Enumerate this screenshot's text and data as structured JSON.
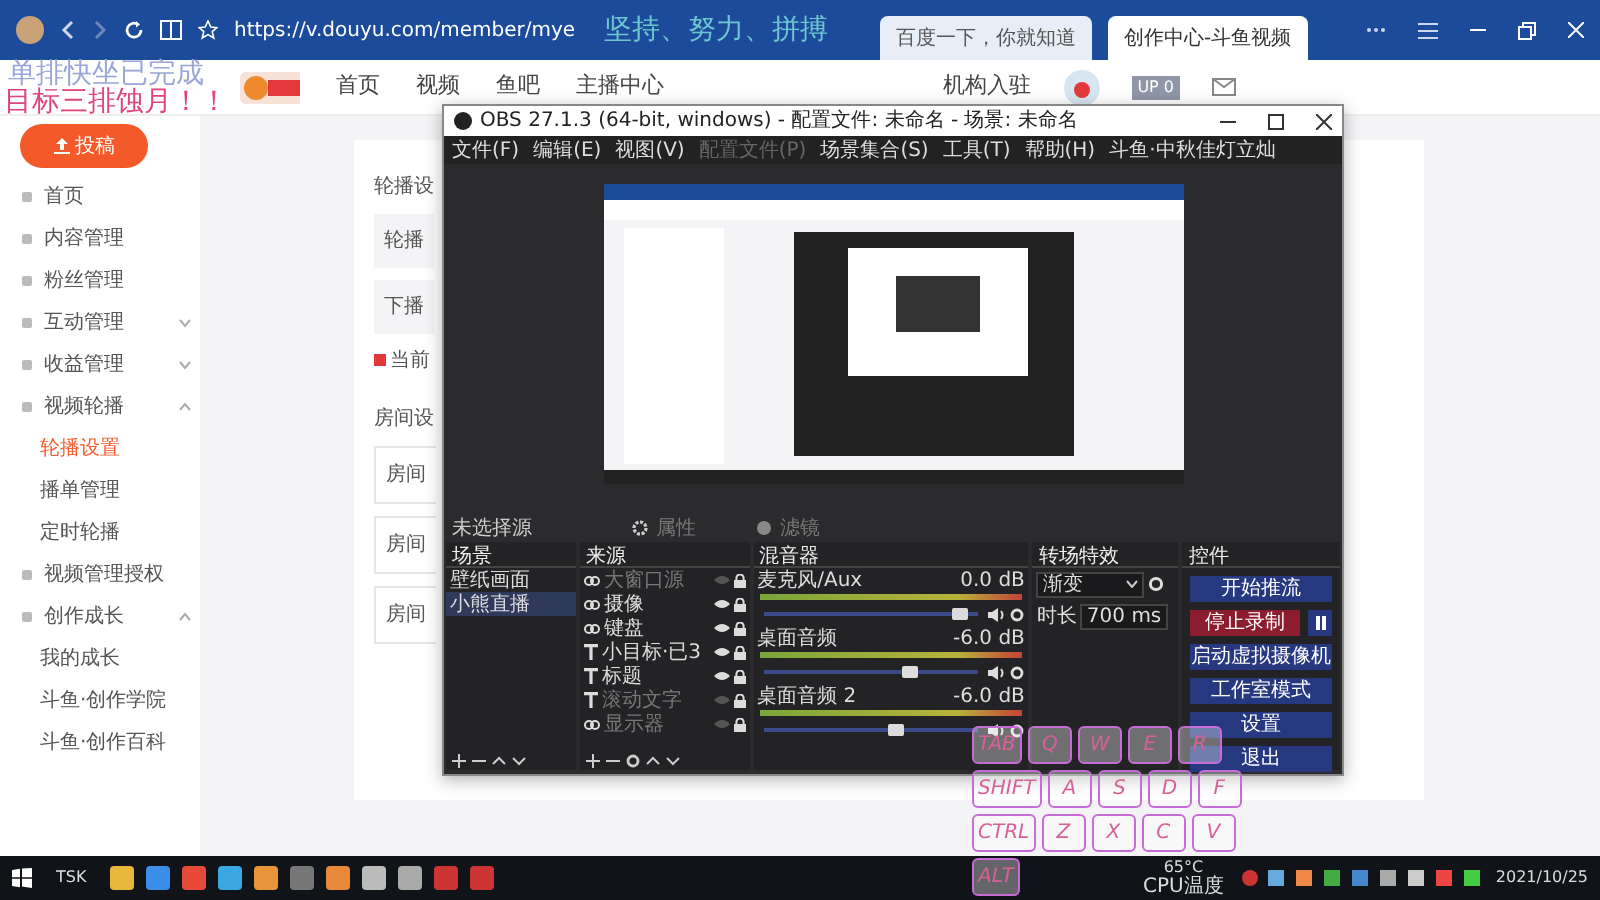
{
  "browser": {
    "url": "https://v.douyu.com/member/mye",
    "tabs": [
      {
        "label": "百度一下，你就知道",
        "selected": false
      },
      {
        "label": "创作中心-斗鱼视频",
        "selected": true
      }
    ]
  },
  "header": {
    "nav": [
      "首页",
      "视频",
      "鱼吧",
      "主播中心"
    ],
    "org_link": "机构入驻",
    "up_badge": "UP 0"
  },
  "sidebar": {
    "upload_button": "投稿",
    "items": [
      {
        "kind": "link",
        "label": "首页",
        "selected": false
      },
      {
        "kind": "link",
        "label": "内容管理",
        "selected": false
      },
      {
        "kind": "link",
        "label": "粉丝管理",
        "selected": false
      },
      {
        "kind": "group",
        "label": "互动管理",
        "expanded": false
      },
      {
        "kind": "group",
        "label": "收益管理",
        "expanded": false
      },
      {
        "kind": "group",
        "label": "视频轮播",
        "expanded": true,
        "children": [
          {
            "label": "轮播设置",
            "selected": true
          },
          {
            "label": "播单管理",
            "selected": false
          },
          {
            "label": "定时轮播",
            "selected": false
          }
        ]
      },
      {
        "kind": "link",
        "label": "视频管理授权",
        "selected": false
      },
      {
        "kind": "group",
        "label": "创作成长",
        "expanded": true,
        "children": [
          {
            "label": "我的成长",
            "selected": false
          },
          {
            "label": "斗鱼·创作学院",
            "selected": false
          },
          {
            "label": "斗鱼·创作百科",
            "selected": false
          }
        ]
      }
    ]
  },
  "page_fragments": [
    {
      "kind": "heading",
      "text": "轮播设"
    },
    {
      "kind": "filled",
      "text": "轮播"
    },
    {
      "kind": "filled",
      "text": "下播"
    },
    {
      "kind": "notice",
      "text": "当前"
    },
    {
      "kind": "heading",
      "text": "房间设"
    },
    {
      "kind": "outlined",
      "text": "房间"
    },
    {
      "kind": "outlined",
      "text": "房间"
    },
    {
      "kind": "outlined",
      "text": "房间"
    }
  ],
  "obs": {
    "title": "OBS 27.1.3 (64-bit, windows) - 配置文件: 未命名 - 场景: 未命名",
    "menu": [
      {
        "label": "文件(F)",
        "disabled": false
      },
      {
        "label": "编辑(E)",
        "disabled": false
      },
      {
        "label": "视图(V)",
        "disabled": false
      },
      {
        "label": "配置文件(P)",
        "disabled": true
      },
      {
        "label": "场景集合(S)",
        "disabled": false
      },
      {
        "label": "工具(T)",
        "disabled": false
      },
      {
        "label": "帮助(H)",
        "disabled": false
      },
      {
        "label": "斗鱼·中秋佳灯立灿",
        "disabled": false
      }
    ],
    "no_source": "未选择源",
    "properties": "属性",
    "filters": "滤镜",
    "scenes": {
      "title": "场景",
      "items": [
        {
          "name": "壁纸画面",
          "selected": false
        },
        {
          "name": "小熊直播",
          "selected": true
        }
      ]
    },
    "sources": {
      "title": "来源",
      "items": [
        {
          "kind": "capture",
          "name": "大窗口源",
          "visible": false
        },
        {
          "kind": "capture",
          "name": "摄像",
          "visible": true
        },
        {
          "kind": "capture",
          "name": "键盘",
          "visible": true
        },
        {
          "kind": "text",
          "name": "小目标·已3",
          "visible": true
        },
        {
          "kind": "text",
          "name": "标题",
          "visible": true
        },
        {
          "kind": "text",
          "name": "滚动文字",
          "visible": false
        },
        {
          "kind": "capture",
          "name": "显示器",
          "visible": false
        }
      ]
    },
    "mixer": {
      "title": "混音器",
      "channels": [
        {
          "name": "麦克风/Aux",
          "reading": "0.0 dB",
          "level": 0.95
        },
        {
          "name": "桌面音频",
          "reading": "-6.0 dB",
          "level": 0.72
        },
        {
          "name": "桌面音频 2",
          "reading": "-6.0 dB",
          "level": 0.65
        }
      ]
    },
    "transitions": {
      "title": "转场特效",
      "type": "渐变",
      "duration_label": "时长",
      "duration": "700 ms"
    },
    "controls": {
      "title": "控件",
      "buttons": [
        {
          "kind": "normal",
          "label": "开始推流"
        },
        {
          "kind": "active",
          "label": "停止录制"
        },
        {
          "kind": "normal",
          "label": "启动虚拟摄像机"
        },
        {
          "kind": "normal",
          "label": "工作室模式"
        },
        {
          "kind": "normal",
          "label": "设置"
        },
        {
          "kind": "normal",
          "label": "退出"
        }
      ]
    }
  },
  "stream_overlay": [
    {
      "text": "单排快坐已完成",
      "color": "#9aa6d8"
    },
    {
      "text": "目标三排蚀月！！",
      "color": "#e0457a"
    },
    {
      "text": "坚持、努力、拼搏",
      "color": "#6cc6d0"
    }
  ],
  "keyboard_overlay": {
    "rows": [
      [
        "TAB",
        "Q",
        "W",
        "E",
        "R"
      ],
      [
        "SHIFT",
        "A",
        "S",
        "D",
        "F"
      ],
      [
        "CTRL",
        "Z",
        "X",
        "C",
        "V"
      ],
      [
        "ALT"
      ]
    ]
  },
  "taskbar": {
    "label": "TSK",
    "temperature": "65°C",
    "temperature_label": "CPU温度",
    "date": "2021/10/25"
  }
}
